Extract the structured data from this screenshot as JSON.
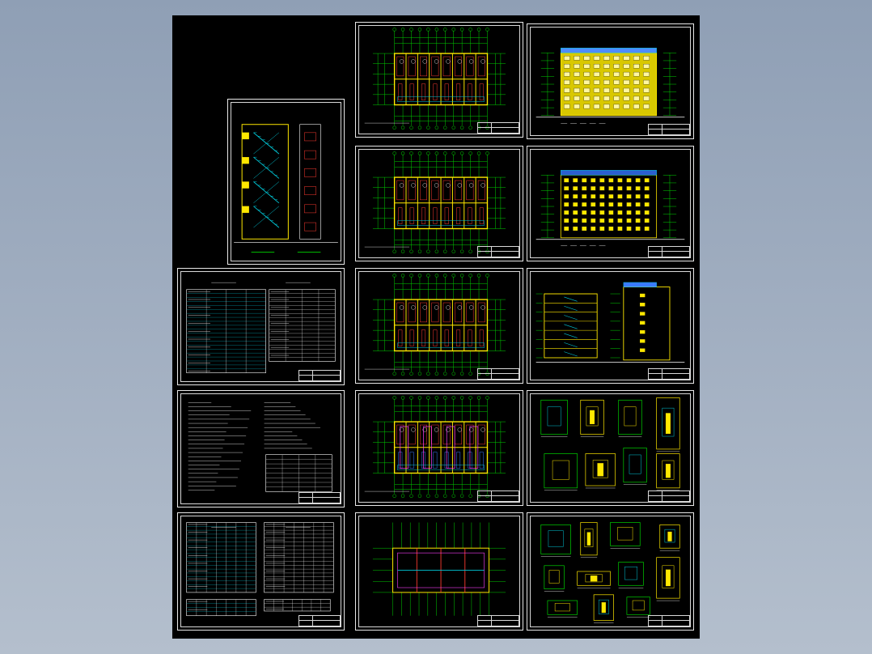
{
  "drawing_set": {
    "description_sheets": [
      {
        "id": "stair-section",
        "type": "stair"
      },
      {
        "id": "door-window-schedule",
        "type": "table"
      },
      {
        "id": "design-notes",
        "type": "notes"
      },
      {
        "id": "materials-schedule",
        "type": "table"
      }
    ],
    "plan_sheets": [
      {
        "id": "floor-plan-1",
        "type": "plan"
      },
      {
        "id": "floor-plan-2",
        "type": "plan"
      },
      {
        "id": "floor-plan-3",
        "type": "plan"
      },
      {
        "id": "floor-plan-4",
        "type": "plan-alt"
      },
      {
        "id": "roof-plan",
        "type": "roof"
      }
    ],
    "elevation_sheets": [
      {
        "id": "front-elevation",
        "type": "elevation"
      },
      {
        "id": "rear-elevation",
        "type": "elevation2"
      },
      {
        "id": "side-sections",
        "type": "section"
      },
      {
        "id": "details-1",
        "type": "details"
      },
      {
        "id": "details-2",
        "type": "details2"
      }
    ]
  },
  "colors": {
    "background": "#000000",
    "sheet_border": "#e8e8e8",
    "grid_green": "#00d200",
    "wall_yellow": "#ffe800",
    "table_cyan": "#00c8d8",
    "room_red": "#ff3b30",
    "accent_magenta": "#ff40ff",
    "accent_blue": "#3a7bff",
    "window_white": "#ffffff"
  }
}
